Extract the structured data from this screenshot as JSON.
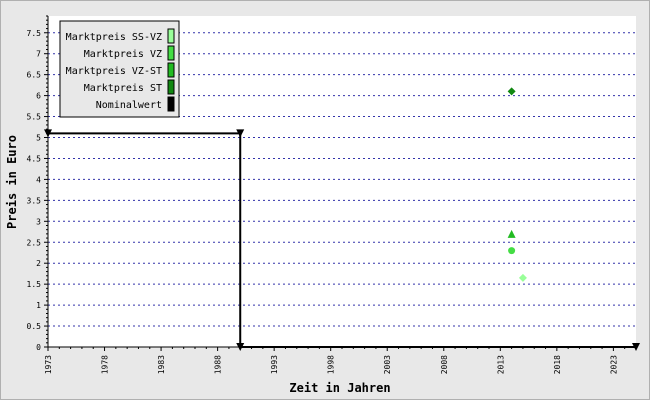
{
  "chart_data": {
    "type": "scatter",
    "xlabel": "Zeit in Jahren",
    "ylabel": "Preis in Euro",
    "xlim": [
      1973,
      2025
    ],
    "ylim": [
      0,
      7.9
    ],
    "x_ticks": [
      "1973",
      "1978",
      "1983",
      "1988",
      "1993",
      "1998",
      "2003",
      "2008",
      "2013",
      "2018",
      "2023"
    ],
    "y_ticks": [
      "0",
      "0.5",
      "1",
      "1.5",
      "2",
      "2.5",
      "3",
      "3.5",
      "4",
      "4.5",
      "5",
      "5.5",
      "6",
      "6.5",
      "7",
      "7.5"
    ],
    "grid": "horizontal dotted",
    "legend_position": "top-left",
    "series": [
      {
        "name": "Marktpreis SS-VZ",
        "color": "#99ff99",
        "marker": "diamond",
        "points": [
          [
            2015,
            1.65
          ]
        ]
      },
      {
        "name": "Marktpreis VZ",
        "color": "#44dd44",
        "marker": "circle",
        "points": [
          [
            2014,
            2.3
          ]
        ]
      },
      {
        "name": "Marktpreis VZ-ST",
        "color": "#22bb22",
        "marker": "triangle",
        "points": [
          [
            2014,
            2.7
          ]
        ]
      },
      {
        "name": "Marktpreis ST",
        "color": "#118811",
        "marker": "diamond",
        "points": [
          [
            2014,
            6.1
          ]
        ]
      },
      {
        "name": "Nominalwert",
        "color": "#000000",
        "marker": "line",
        "points": [
          [
            1973,
            5.1
          ],
          [
            1990,
            5.1
          ],
          [
            1990,
            0
          ],
          [
            2025,
            0
          ]
        ]
      }
    ]
  }
}
